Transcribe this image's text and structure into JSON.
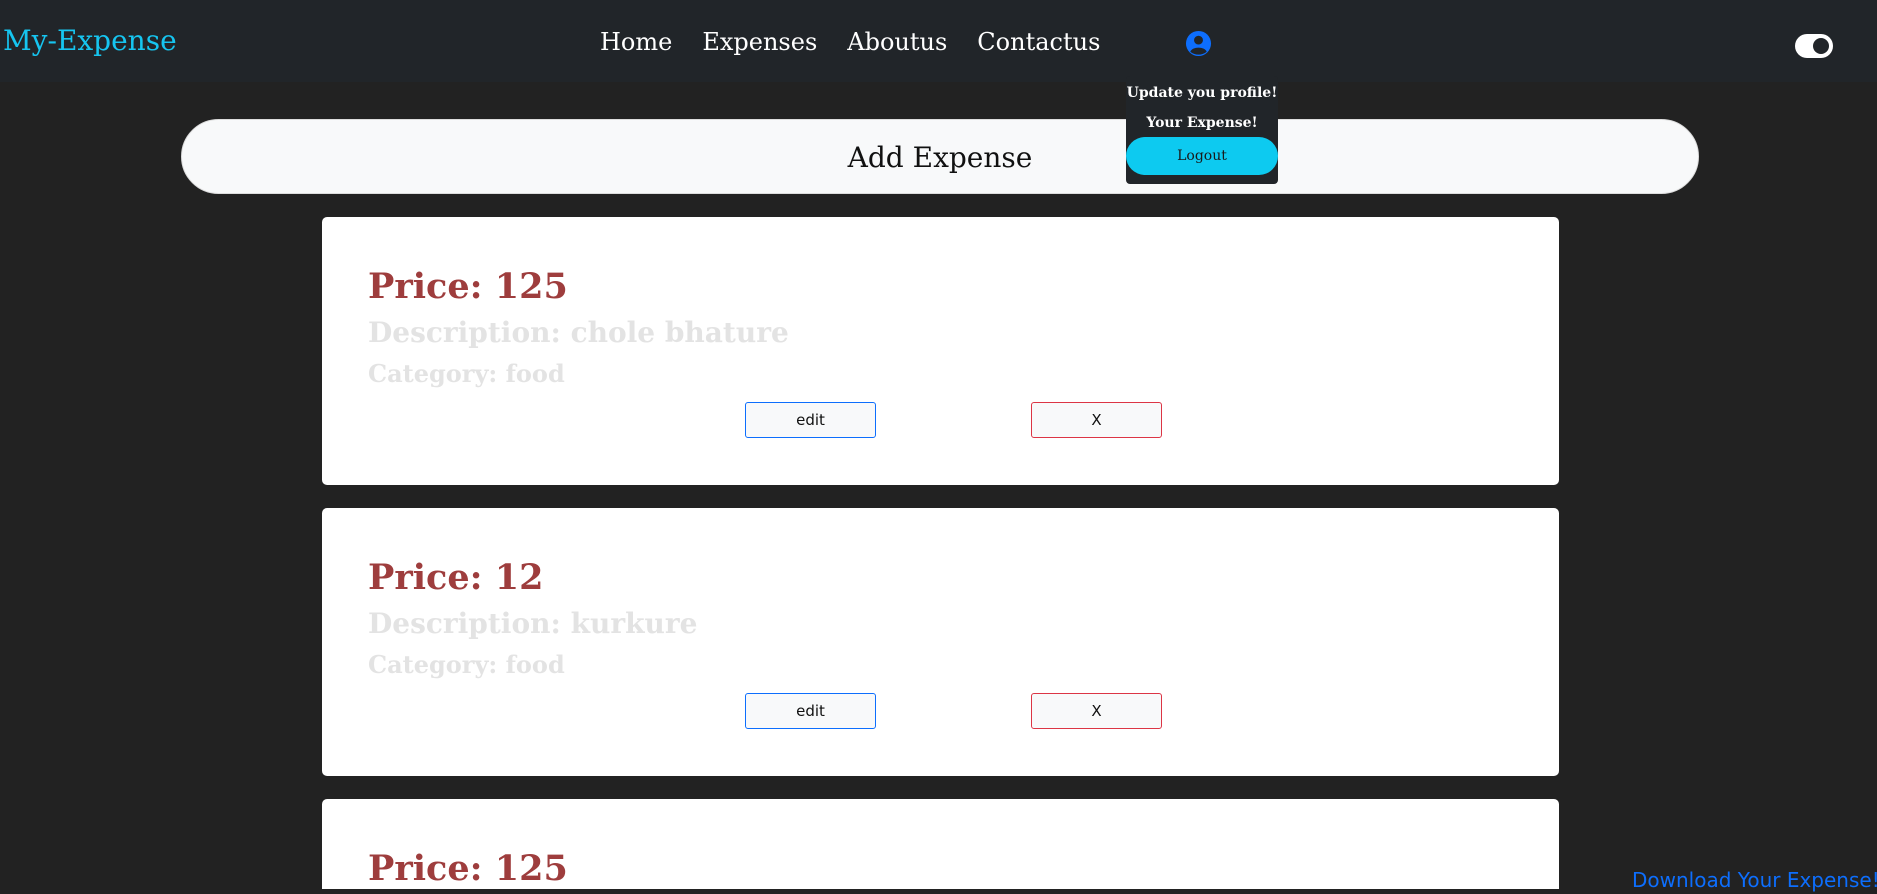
{
  "navbar": {
    "brand": "My-Expense",
    "links": [
      "Home",
      "Expenses",
      "Aboutus",
      "Contactus"
    ],
    "brand_color": "#16c5f0",
    "background": "#212529"
  },
  "profile_menu": {
    "items": [
      "Update you profile!",
      "Your Expense!"
    ],
    "logout_label": "Logout",
    "logout_color": "#0dcaf0"
  },
  "theme_toggle": {
    "icon": "toggle-icon",
    "state": "on"
  },
  "add_expense": {
    "label": "Add Expense"
  },
  "expenses": [
    {
      "price": "Price: 125",
      "description": "Description: chole bhature",
      "category": "Category: food",
      "edit_label": "edit",
      "delete_label": "X"
    },
    {
      "price": "Price: 12",
      "description": "Description: kurkure",
      "category": "Category: food",
      "edit_label": "edit",
      "delete_label": "X"
    },
    {
      "price": "Price: 125",
      "description": "",
      "category": "",
      "edit_label": "",
      "delete_label": ""
    }
  ],
  "download": {
    "label": "Download Your Expense!"
  },
  "colors": {
    "page_bg": "#222222",
    "price_text": "#9e3d3d",
    "edit_border": "#0d6efd",
    "delete_border": "#dc3545",
    "link": "#0d6efd"
  }
}
